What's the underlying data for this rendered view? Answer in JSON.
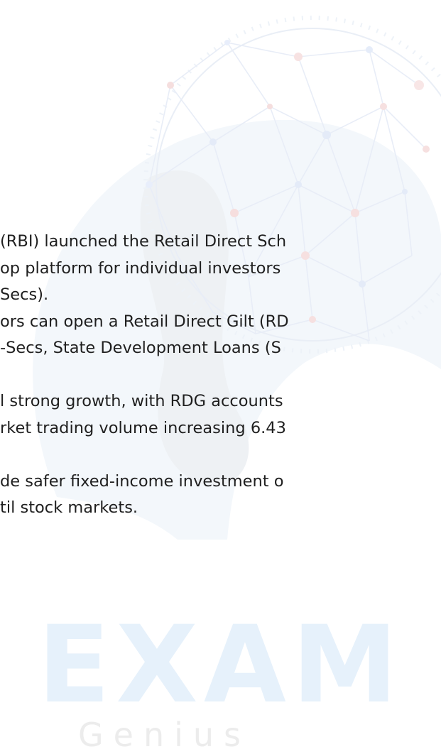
{
  "watermark": {
    "primary": "EXAM",
    "secondary": "Genius"
  },
  "content": {
    "lines": [
      "(RBI) launched the Retail Direct Sch",
      "op platform for individual investors",
      "Secs).",
      "ors can open a Retail Direct Gilt (RD",
      "-Secs, State Development Loans (S",
      "",
      "l strong growth, with RDG accounts",
      "rket trading volume increasing 6.43",
      "",
      "de safer fixed-income investment o",
      "til stock markets."
    ]
  },
  "colors": {
    "text": "#1f1f1f",
    "watermark_blue": "#e6f1fb",
    "watermark_gray": "#ececec"
  }
}
